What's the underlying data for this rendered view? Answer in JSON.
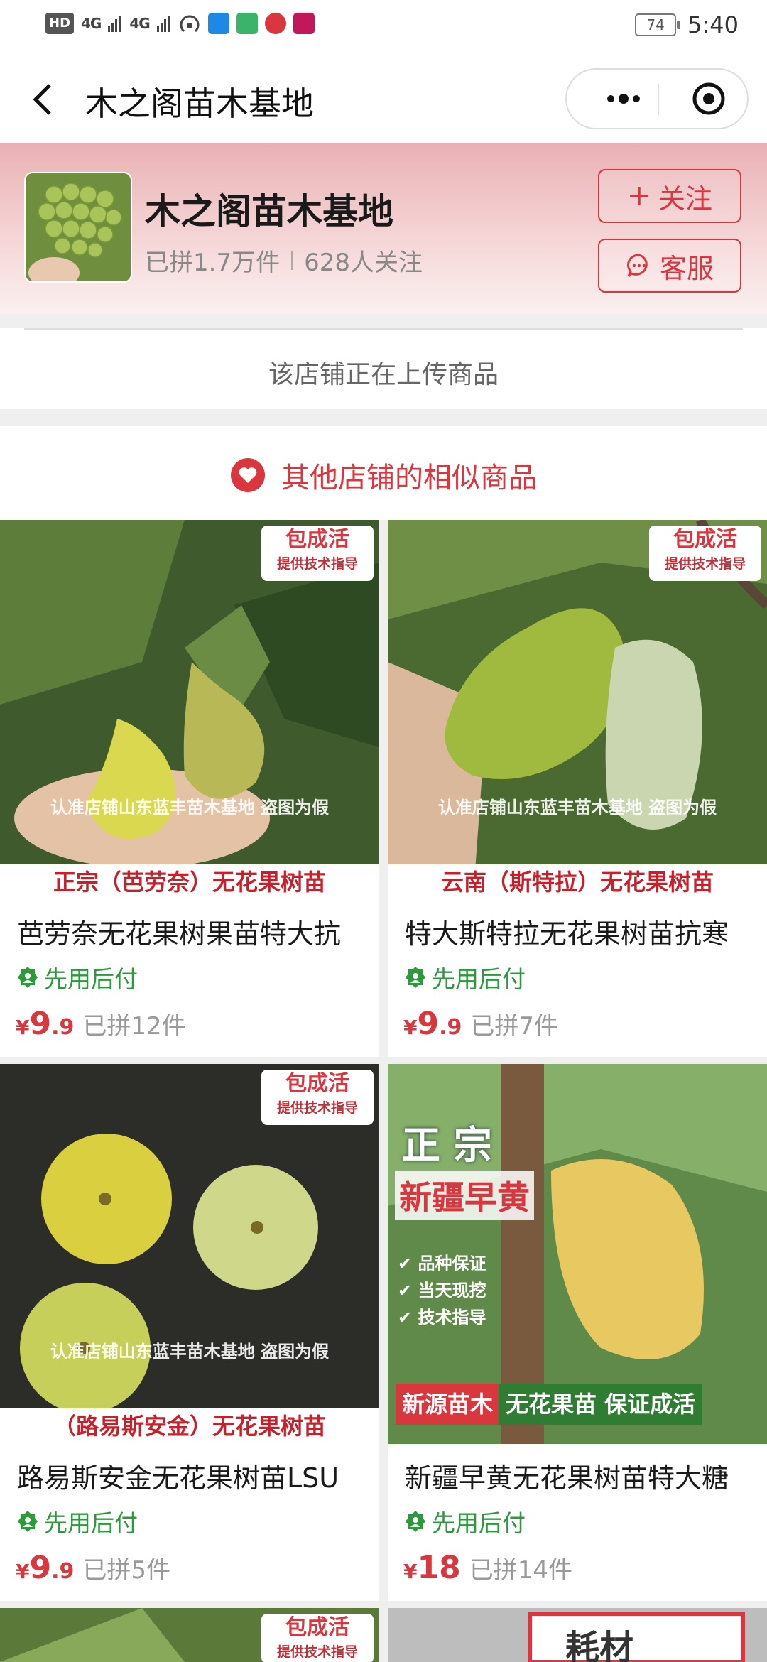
{
  "status_bar": {
    "network_left": "HD",
    "signal_1": "4G",
    "signal_2": "4G",
    "battery": "74",
    "time": "5:40"
  },
  "nav": {
    "title": "木之阁苗木基地"
  },
  "store": {
    "name": "木之阁苗木基地",
    "sold": "已拼1.7万件",
    "followers": "628人关注",
    "follow_label": "关注",
    "service_label": "客服"
  },
  "uploading_text": "该店铺正在上传商品",
  "similar_heading": "其他店铺的相似商品",
  "products": [
    {
      "title": "芭劳奈无花果树果苗特大抗",
      "tag": "先用后付",
      "price_symbol": "¥",
      "price_int": "9",
      "price_dec": ".9",
      "sold": "已拼12件",
      "badge_1": "包成活",
      "badge_2": "提供技术指导",
      "watermark": "认准店铺山东蓝丰苗木基地 盗图为假",
      "banner": "正宗（芭劳奈）无花果树苗"
    },
    {
      "title": "特大斯特拉无花果树苗抗寒",
      "tag": "先用后付",
      "price_symbol": "¥",
      "price_int": "9",
      "price_dec": ".9",
      "sold": "已拼7件",
      "badge_1": "包成活",
      "badge_2": "提供技术指导",
      "watermark": "认准店铺山东蓝丰苗木基地 盗图为假",
      "banner": "云南（斯特拉）无花果树苗"
    },
    {
      "title": "路易斯安金无花果树苗LSU",
      "tag": "先用后付",
      "price_symbol": "¥",
      "price_int": "9",
      "price_dec": ".9",
      "sold": "已拼5件",
      "badge_1": "包成活",
      "badge_2": "提供技术指导",
      "watermark": "认准店铺山东蓝丰苗木基地 盗图为假",
      "banner": "（路易斯安金）无花果树苗"
    },
    {
      "title": "新疆早黄无花果树苗特大糖",
      "tag": "先用后付",
      "price_symbol": "¥",
      "price_int": "18",
      "price_dec": "",
      "sold": "已拼14件",
      "img_heading": "正  宗",
      "img_sub": "新疆早黄",
      "img_points": [
        "品种保证",
        "当天现挖",
        "技术指导"
      ],
      "img_banner_left": "新源苗木",
      "img_banner_right": "无花果苗 保证成活"
    }
  ],
  "partial_cards": [
    {
      "badge_1": "包成活",
      "badge_2": "提供技术指导"
    },
    {
      "text": "耗材"
    }
  ],
  "colors": {
    "accent": "#d9363e",
    "tag_green": "#2a9a3a"
  }
}
